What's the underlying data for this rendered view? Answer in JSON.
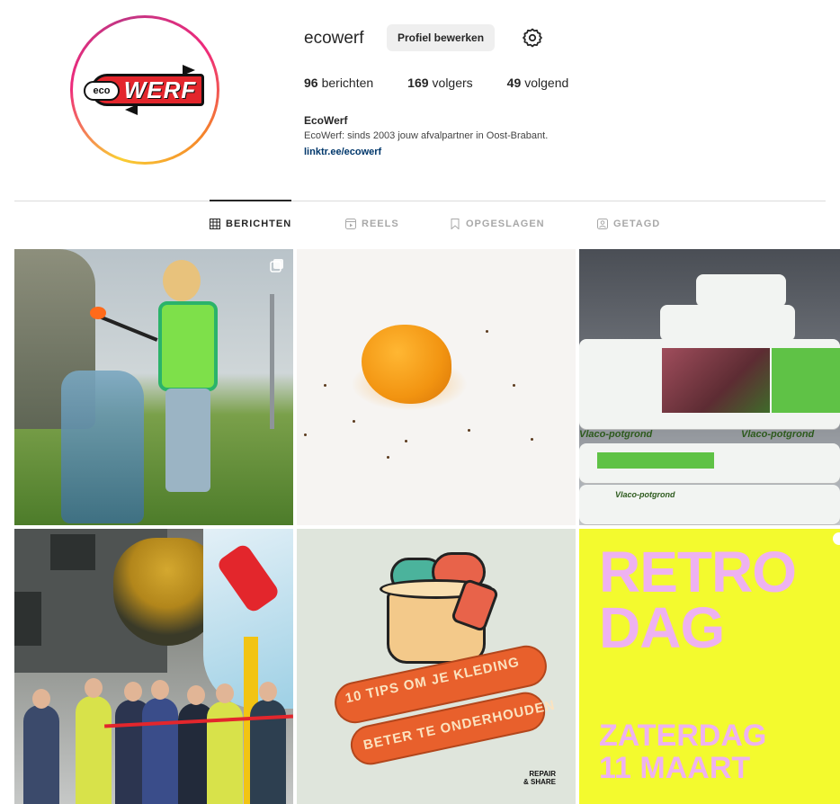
{
  "profile": {
    "username": "ecowerf",
    "edit_label": "Profiel bewerken",
    "logo_eco": "eco",
    "logo_werf": "WERF",
    "stats": [
      {
        "num": "96",
        "label": "berichten"
      },
      {
        "num": "169",
        "label": "volgers"
      },
      {
        "num": "49",
        "label": "volgend"
      }
    ],
    "bio_name": "EcoWerf",
    "bio_text": "EcoWerf: sinds 2003 jouw afvalpartner in Oost-Brabant.",
    "bio_link": "linktr.ee/ecowerf"
  },
  "tabs": [
    {
      "label": "BERICHTEN",
      "icon": "grid-icon",
      "active": true
    },
    {
      "label": "REELS",
      "icon": "reels-icon",
      "active": false
    },
    {
      "label": "OPGESLAGEN",
      "icon": "bookmark-icon",
      "active": false
    },
    {
      "label": "GETAGD",
      "icon": "tag-icon",
      "active": false
    }
  ],
  "posts": {
    "soil_bag_text_1": "Vlaco-potgrond",
    "soil_bag_text_2": "Vlaco-potgrond",
    "soil_bag_text_3": "Vlaco-potgrond",
    "laundry_line1": "10 TIPS OM JE KLEDING",
    "laundry_line2": "BETER TE ONDERHOUDEN",
    "laundry_brand": "REPAIR\n& SHARE",
    "retro_line1": "RETRO",
    "retro_line2": "DAG",
    "retro_line3": "ZATERDAG",
    "retro_line4": "11 MAART"
  },
  "colors": {
    "accent_link": "#00376b",
    "retro_bg": "#f3fa2e",
    "retro_text": "#eeb2f0",
    "brand_red": "#e3262c"
  }
}
